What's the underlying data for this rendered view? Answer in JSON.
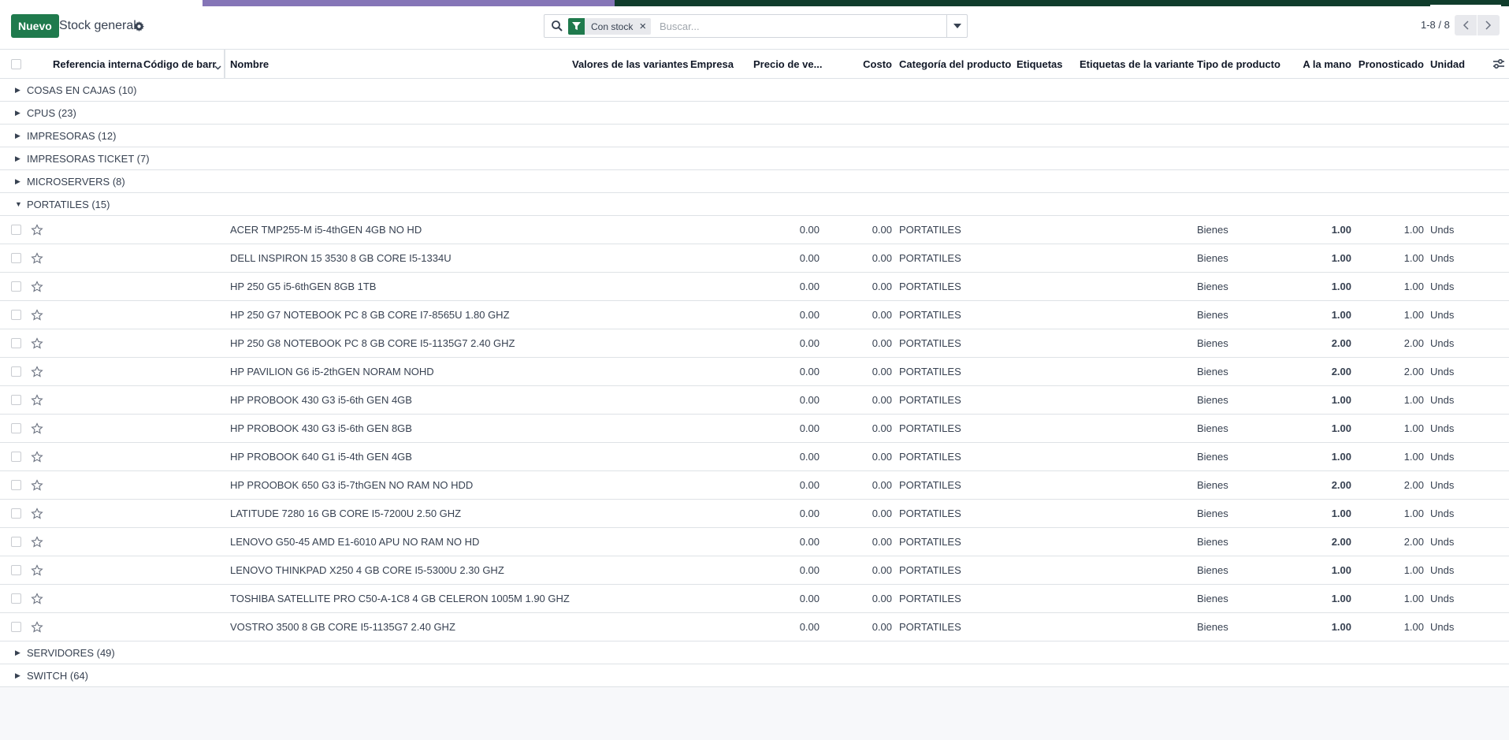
{
  "toolbar": {
    "new_label": "Nuevo",
    "view_title": "Stock general"
  },
  "search": {
    "facet_label": "Con stock",
    "placeholder": "Buscar..."
  },
  "pager": {
    "text": "1-8 / 8"
  },
  "colors": {
    "primary": "#1f7a4d",
    "navbar_dark": "#103d2c",
    "navbar_purple": "#8575b7"
  },
  "columns": {
    "ref": "Referencia interna",
    "barcode": "Código de barr",
    "name": "Nombre",
    "variants": "Valores de las variantes",
    "company": "Empresa",
    "price": "Precio de ve...",
    "cost": "Costo",
    "category": "Categoría del producto",
    "tags": "Etiquetas",
    "variant_tags": "Etiquetas de la variante",
    "type": "Tipo de producto",
    "on_hand": "A la mano",
    "forecast": "Pronosticado",
    "uom": "Unidad"
  },
  "groups_before": [
    "COSAS EN CAJAS (10)",
    "CPUS (23)",
    "IMPRESORAS (12)",
    "IMPRESORAS TICKET (7)",
    "MICROSERVERS (8)"
  ],
  "open_group": "PORTATILES (15)",
  "rows": [
    {
      "name": "ACER TMP255-M i5-4thGEN 4GB NO HD",
      "price": "0.00",
      "cost": "0.00",
      "category": "PORTATILES",
      "type": "Bienes",
      "on_hand": "1.00",
      "forecast": "1.00",
      "uom": "Unds"
    },
    {
      "name": "DELL INSPIRON 15 3530 8 GB CORE I5-1334U",
      "price": "0.00",
      "cost": "0.00",
      "category": "PORTATILES",
      "type": "Bienes",
      "on_hand": "1.00",
      "forecast": "1.00",
      "uom": "Unds"
    },
    {
      "name": "HP 250 G5 i5-6thGEN 8GB 1TB",
      "price": "0.00",
      "cost": "0.00",
      "category": "PORTATILES",
      "type": "Bienes",
      "on_hand": "1.00",
      "forecast": "1.00",
      "uom": "Unds"
    },
    {
      "name": "HP 250 G7 NOTEBOOK PC 8 GB CORE I7-8565U 1.80 GHZ",
      "price": "0.00",
      "cost": "0.00",
      "category": "PORTATILES",
      "type": "Bienes",
      "on_hand": "1.00",
      "forecast": "1.00",
      "uom": "Unds"
    },
    {
      "name": "HP 250 G8 NOTEBOOK PC 8 GB CORE I5-1135G7 2.40 GHZ",
      "price": "0.00",
      "cost": "0.00",
      "category": "PORTATILES",
      "type": "Bienes",
      "on_hand": "2.00",
      "forecast": "2.00",
      "uom": "Unds"
    },
    {
      "name": "HP PAVILION G6 i5-2thGEN NORAM NOHD",
      "price": "0.00",
      "cost": "0.00",
      "category": "PORTATILES",
      "type": "Bienes",
      "on_hand": "2.00",
      "forecast": "2.00",
      "uom": "Unds"
    },
    {
      "name": "HP PROBOOK 430 G3 i5-6th GEN 4GB",
      "price": "0.00",
      "cost": "0.00",
      "category": "PORTATILES",
      "type": "Bienes",
      "on_hand": "1.00",
      "forecast": "1.00",
      "uom": "Unds"
    },
    {
      "name": "HP PROBOOK 430 G3 i5-6th GEN 8GB",
      "price": "0.00",
      "cost": "0.00",
      "category": "PORTATILES",
      "type": "Bienes",
      "on_hand": "1.00",
      "forecast": "1.00",
      "uom": "Unds"
    },
    {
      "name": "HP PROBOOK 640 G1 i5-4th GEN 4GB",
      "price": "0.00",
      "cost": "0.00",
      "category": "PORTATILES",
      "type": "Bienes",
      "on_hand": "1.00",
      "forecast": "1.00",
      "uom": "Unds"
    },
    {
      "name": "HP PROOBOK 650 G3 i5-7thGEN NO RAM NO HDD",
      "price": "0.00",
      "cost": "0.00",
      "category": "PORTATILES",
      "type": "Bienes",
      "on_hand": "2.00",
      "forecast": "2.00",
      "uom": "Unds"
    },
    {
      "name": "LATITUDE 7280 16 GB CORE I5-7200U 2.50 GHZ",
      "price": "0.00",
      "cost": "0.00",
      "category": "PORTATILES",
      "type": "Bienes",
      "on_hand": "1.00",
      "forecast": "1.00",
      "uom": "Unds"
    },
    {
      "name": "LENOVO G50-45 AMD E1-6010 APU NO RAM NO HD",
      "price": "0.00",
      "cost": "0.00",
      "category": "PORTATILES",
      "type": "Bienes",
      "on_hand": "2.00",
      "forecast": "2.00",
      "uom": "Unds"
    },
    {
      "name": "LENOVO THINKPAD X250 4 GB CORE I5-5300U 2.30 GHZ",
      "price": "0.00",
      "cost": "0.00",
      "category": "PORTATILES",
      "type": "Bienes",
      "on_hand": "1.00",
      "forecast": "1.00",
      "uom": "Unds"
    },
    {
      "name": "TOSHIBA SATELLITE PRO C50-A-1C8 4 GB CELERON 1005M 1.90 GHZ",
      "price": "0.00",
      "cost": "0.00",
      "category": "PORTATILES",
      "type": "Bienes",
      "on_hand": "1.00",
      "forecast": "1.00",
      "uom": "Unds"
    },
    {
      "name": "VOSTRO 3500 8 GB CORE I5-1135G7 2.40 GHZ",
      "price": "0.00",
      "cost": "0.00",
      "category": "PORTATILES",
      "type": "Bienes",
      "on_hand": "1.00",
      "forecast": "1.00",
      "uom": "Unds"
    }
  ],
  "groups_after": [
    "SERVIDORES (49)",
    "SWITCH (64)"
  ]
}
